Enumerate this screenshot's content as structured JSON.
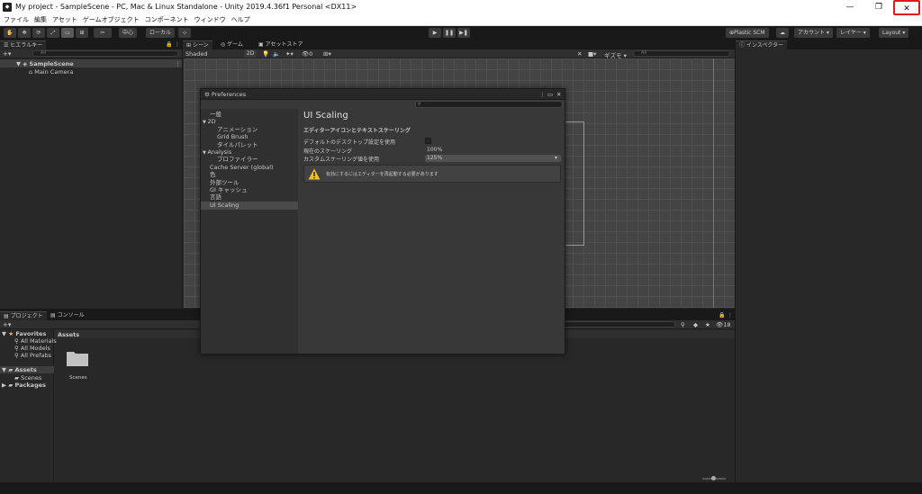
{
  "window": {
    "title": "My project - SampleScene - PC, Mac & Linux Standalone - Unity 2019.4.36f1 Personal <DX11>",
    "minimize": "—",
    "maximize": "❐",
    "close": "✕"
  },
  "menu": [
    "ファイル",
    "編集",
    "アセット",
    "ゲームオブジェクト",
    "コンポーネント",
    "ウィンドウ",
    "ヘルプ"
  ],
  "toolbar": {
    "pivot": "中心",
    "space": "ローカル",
    "play": "▶",
    "pause": "❚❚",
    "step": "▶❚",
    "plastic": "Plastic SCM",
    "cloud": "☁",
    "account": "アカウント",
    "layers": "レイヤー",
    "layout": "Layout"
  },
  "hierarchy": {
    "tab": "ヒエラルキー",
    "add": "+▾",
    "search_placeholder": "All",
    "scene": "SampleScene",
    "items": [
      "Main Camera"
    ]
  },
  "scene_view": {
    "tabs": [
      "シーン",
      "ゲーム",
      "アセットストア"
    ],
    "shading": "Shaded",
    "mode_2d": "2D",
    "gizmos": "ギズモ",
    "search_placeholder": "All",
    "fx_count": "0"
  },
  "inspector": {
    "tab": "インスペクター"
  },
  "preferences": {
    "title": "Preferences",
    "categories": [
      {
        "label": "一般",
        "indent": 0
      },
      {
        "label": "2D",
        "indent": 0,
        "arrow": "▼"
      },
      {
        "label": "アニメーション",
        "indent": 2
      },
      {
        "label": "Grid Brush",
        "indent": 2
      },
      {
        "label": "タイルパレット",
        "indent": 2
      },
      {
        "label": "Analysis",
        "indent": 0,
        "arrow": "▼"
      },
      {
        "label": "プロファイラー",
        "indent": 2
      },
      {
        "label": "Cache Server (global)",
        "indent": 0
      },
      {
        "label": "色",
        "indent": 0
      },
      {
        "label": "外部ツール",
        "indent": 0
      },
      {
        "label": "GI キャッシュ",
        "indent": 0
      },
      {
        "label": "言語",
        "indent": 0
      },
      {
        "label": "UI Scaling",
        "indent": 0,
        "selected": true
      }
    ],
    "heading": "UI Scaling",
    "section": "エディターアイコンとテキストスケーリング",
    "use_default_label": "デフォルトのデスクトップ設定を使用",
    "current_scaling_label": "現在のスケーリング",
    "current_scaling_value": "100%",
    "custom_scaling_label": "カスタムスケーリング値を使用",
    "custom_scaling_value": "125%",
    "warning": "有効にするにはエディターを再起動する必要があります"
  },
  "project": {
    "tabs": [
      "プロジェクト",
      "コンソール"
    ],
    "add": "+▾",
    "favorites": "Favorites",
    "favorite_items": [
      "All Materials",
      "All Models",
      "All Prefabs"
    ],
    "assets": "Assets",
    "asset_children": [
      "Scenes"
    ],
    "packages": "Packages",
    "breadcrumb": "Assets",
    "folders": [
      "Scenes"
    ],
    "count": "18"
  },
  "colors": {
    "close_highlight": "#e01818",
    "warning": "#f0c030",
    "selected": "#4a4a4a"
  }
}
